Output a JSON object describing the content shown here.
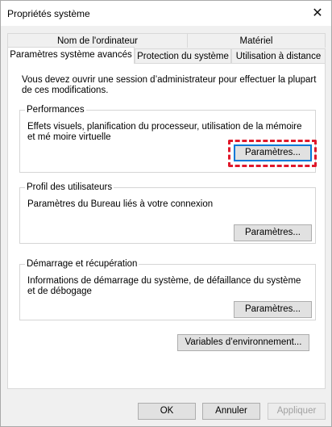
{
  "window": {
    "title": "Propriétés système",
    "close_symbol": "✕"
  },
  "tabs": {
    "row_back": [
      "Nom de l'ordinateur",
      "Matériel"
    ],
    "row_front": [
      "Paramètres système avancés",
      "Protection du système",
      "Utilisation à distance"
    ]
  },
  "panel": {
    "intro": "Vous devez ouvrir une session d’administrateur pour effectuer la plupart de ces modifications.",
    "performance": {
      "title": "Performances",
      "description": "Effets visuels, planification du processeur, utilisation de la mémoire et mé moire virtuelle",
      "button": "Paramètres..."
    },
    "user_profiles": {
      "title": "Profil des utilisateurs",
      "description": "Paramètres du Bureau liés à votre connexion",
      "button": "Paramètres..."
    },
    "startup": {
      "title": "Démarrage et récupération",
      "description": "Informations de démarrage du système, de défaillance du système et de débogage",
      "button": "Paramètres..."
    },
    "env_button": "Variables d’environnement..."
  },
  "footer": {
    "ok": "OK",
    "cancel": "Annuler",
    "apply": "Appliquer"
  },
  "colors": {
    "highlight": "#e0192b",
    "focus": "#0078d7"
  }
}
